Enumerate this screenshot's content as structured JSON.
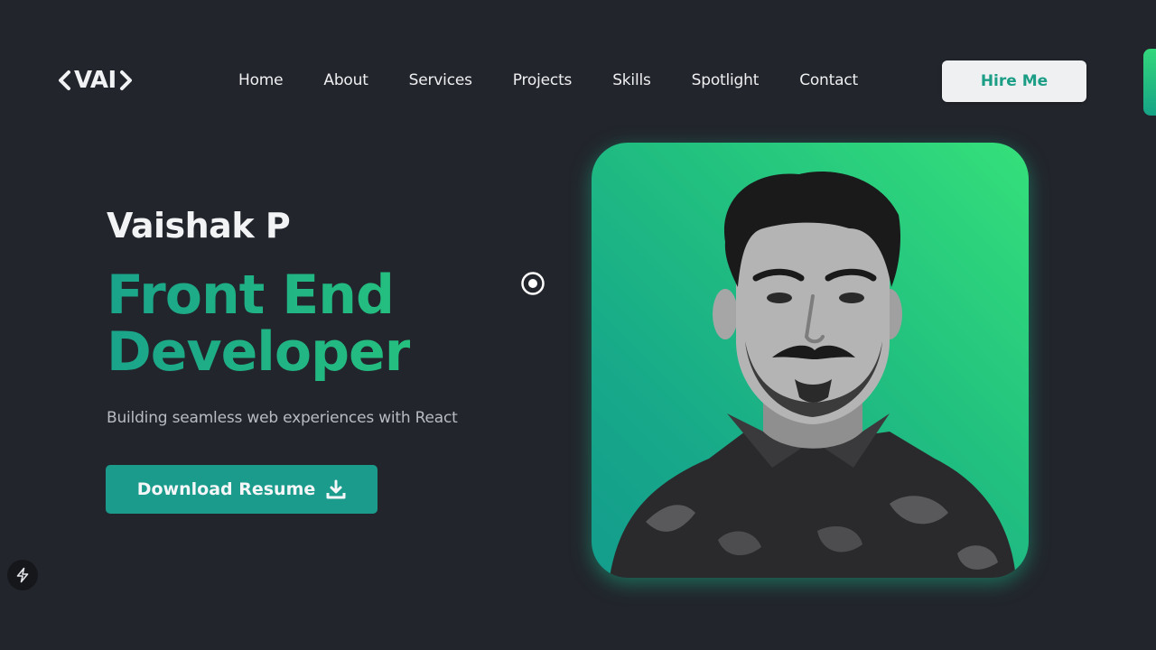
{
  "header": {
    "logo_text": "VAI",
    "nav": [
      "Home",
      "About",
      "Services",
      "Projects",
      "Skills",
      "Spotlight",
      "Contact"
    ],
    "cta_label": "Hire Me"
  },
  "hero": {
    "name": "Vaishak P",
    "role_line1": "Front End",
    "role_line2": "Developer",
    "tagline": "Building seamless web experiences with React",
    "download_label": "Download Resume"
  },
  "icons": {
    "logo_left": "chevron-left-icon",
    "logo_right": "chevron-right-icon",
    "download": "download-icon",
    "cursor": "target-cursor-icon",
    "floating": "lightning-bolt-icon"
  },
  "colors": {
    "background": "#22252c",
    "accent": "#1b9b8c",
    "accent_bright": "#35e07a",
    "cta_text": "#1c9e86"
  }
}
